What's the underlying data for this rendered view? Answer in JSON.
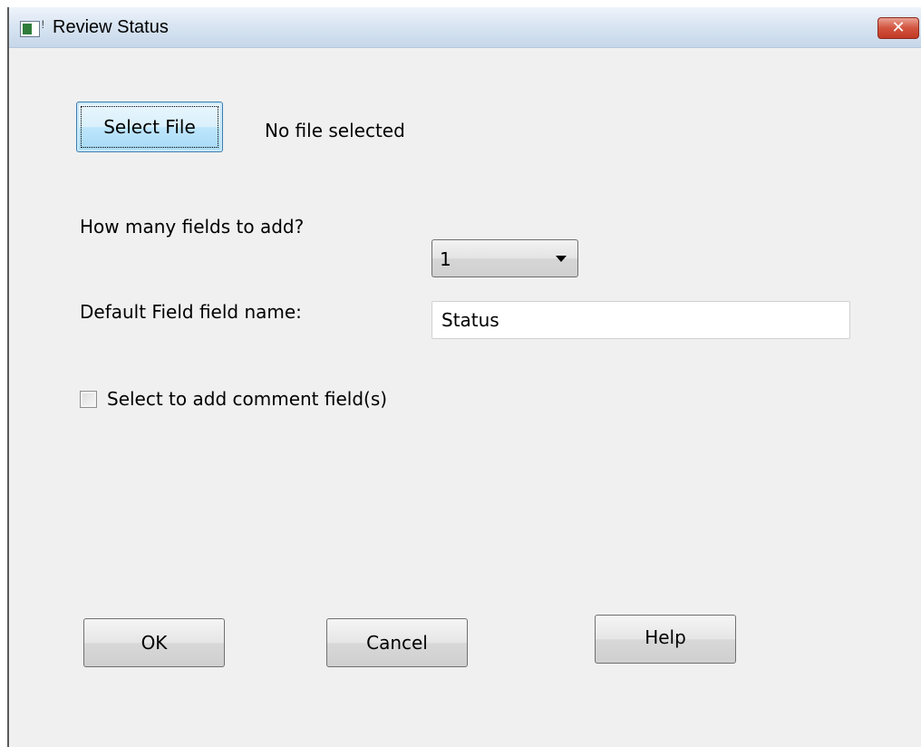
{
  "window": {
    "title": "Review Status",
    "close_glyph": "✕"
  },
  "file": {
    "select_label": "Select File",
    "status_text": "No file selected"
  },
  "fields": {
    "count_label": "How many fields to add?",
    "count_value": "1",
    "name_label": "Default Field field name:",
    "name_value": "Status"
  },
  "comment": {
    "checkbox_label": "Select to add comment field(s)",
    "checked": false
  },
  "buttons": {
    "ok": "OK",
    "cancel": "Cancel",
    "help": "Help"
  },
  "icons": {
    "app": "app-window-icon",
    "close": "close-icon",
    "dropdown": "chevron-down-icon"
  }
}
